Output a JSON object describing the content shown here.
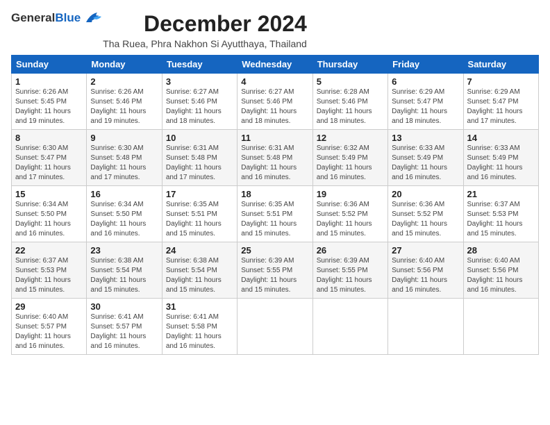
{
  "header": {
    "logo_general": "General",
    "logo_blue": "Blue",
    "month_title": "December 2024",
    "location": "Tha Ruea, Phra Nakhon Si Ayutthaya, Thailand"
  },
  "weekdays": [
    "Sunday",
    "Monday",
    "Tuesday",
    "Wednesday",
    "Thursday",
    "Friday",
    "Saturday"
  ],
  "weeks": [
    [
      {
        "day": "1",
        "info": "Sunrise: 6:26 AM\nSunset: 5:45 PM\nDaylight: 11 hours\nand 19 minutes."
      },
      {
        "day": "2",
        "info": "Sunrise: 6:26 AM\nSunset: 5:46 PM\nDaylight: 11 hours\nand 19 minutes."
      },
      {
        "day": "3",
        "info": "Sunrise: 6:27 AM\nSunset: 5:46 PM\nDaylight: 11 hours\nand 18 minutes."
      },
      {
        "day": "4",
        "info": "Sunrise: 6:27 AM\nSunset: 5:46 PM\nDaylight: 11 hours\nand 18 minutes."
      },
      {
        "day": "5",
        "info": "Sunrise: 6:28 AM\nSunset: 5:46 PM\nDaylight: 11 hours\nand 18 minutes."
      },
      {
        "day": "6",
        "info": "Sunrise: 6:29 AM\nSunset: 5:47 PM\nDaylight: 11 hours\nand 18 minutes."
      },
      {
        "day": "7",
        "info": "Sunrise: 6:29 AM\nSunset: 5:47 PM\nDaylight: 11 hours\nand 17 minutes."
      }
    ],
    [
      {
        "day": "8",
        "info": "Sunrise: 6:30 AM\nSunset: 5:47 PM\nDaylight: 11 hours\nand 17 minutes."
      },
      {
        "day": "9",
        "info": "Sunrise: 6:30 AM\nSunset: 5:48 PM\nDaylight: 11 hours\nand 17 minutes."
      },
      {
        "day": "10",
        "info": "Sunrise: 6:31 AM\nSunset: 5:48 PM\nDaylight: 11 hours\nand 17 minutes."
      },
      {
        "day": "11",
        "info": "Sunrise: 6:31 AM\nSunset: 5:48 PM\nDaylight: 11 hours\nand 16 minutes."
      },
      {
        "day": "12",
        "info": "Sunrise: 6:32 AM\nSunset: 5:49 PM\nDaylight: 11 hours\nand 16 minutes."
      },
      {
        "day": "13",
        "info": "Sunrise: 6:33 AM\nSunset: 5:49 PM\nDaylight: 11 hours\nand 16 minutes."
      },
      {
        "day": "14",
        "info": "Sunrise: 6:33 AM\nSunset: 5:49 PM\nDaylight: 11 hours\nand 16 minutes."
      }
    ],
    [
      {
        "day": "15",
        "info": "Sunrise: 6:34 AM\nSunset: 5:50 PM\nDaylight: 11 hours\nand 16 minutes."
      },
      {
        "day": "16",
        "info": "Sunrise: 6:34 AM\nSunset: 5:50 PM\nDaylight: 11 hours\nand 16 minutes."
      },
      {
        "day": "17",
        "info": "Sunrise: 6:35 AM\nSunset: 5:51 PM\nDaylight: 11 hours\nand 15 minutes."
      },
      {
        "day": "18",
        "info": "Sunrise: 6:35 AM\nSunset: 5:51 PM\nDaylight: 11 hours\nand 15 minutes."
      },
      {
        "day": "19",
        "info": "Sunrise: 6:36 AM\nSunset: 5:52 PM\nDaylight: 11 hours\nand 15 minutes."
      },
      {
        "day": "20",
        "info": "Sunrise: 6:36 AM\nSunset: 5:52 PM\nDaylight: 11 hours\nand 15 minutes."
      },
      {
        "day": "21",
        "info": "Sunrise: 6:37 AM\nSunset: 5:53 PM\nDaylight: 11 hours\nand 15 minutes."
      }
    ],
    [
      {
        "day": "22",
        "info": "Sunrise: 6:37 AM\nSunset: 5:53 PM\nDaylight: 11 hours\nand 15 minutes."
      },
      {
        "day": "23",
        "info": "Sunrise: 6:38 AM\nSunset: 5:54 PM\nDaylight: 11 hours\nand 15 minutes."
      },
      {
        "day": "24",
        "info": "Sunrise: 6:38 AM\nSunset: 5:54 PM\nDaylight: 11 hours\nand 15 minutes."
      },
      {
        "day": "25",
        "info": "Sunrise: 6:39 AM\nSunset: 5:55 PM\nDaylight: 11 hours\nand 15 minutes."
      },
      {
        "day": "26",
        "info": "Sunrise: 6:39 AM\nSunset: 5:55 PM\nDaylight: 11 hours\nand 15 minutes."
      },
      {
        "day": "27",
        "info": "Sunrise: 6:40 AM\nSunset: 5:56 PM\nDaylight: 11 hours\nand 16 minutes."
      },
      {
        "day": "28",
        "info": "Sunrise: 6:40 AM\nSunset: 5:56 PM\nDaylight: 11 hours\nand 16 minutes."
      }
    ],
    [
      {
        "day": "29",
        "info": "Sunrise: 6:40 AM\nSunset: 5:57 PM\nDaylight: 11 hours\nand 16 minutes."
      },
      {
        "day": "30",
        "info": "Sunrise: 6:41 AM\nSunset: 5:57 PM\nDaylight: 11 hours\nand 16 minutes."
      },
      {
        "day": "31",
        "info": "Sunrise: 6:41 AM\nSunset: 5:58 PM\nDaylight: 11 hours\nand 16 minutes."
      },
      {
        "day": "",
        "info": ""
      },
      {
        "day": "",
        "info": ""
      },
      {
        "day": "",
        "info": ""
      },
      {
        "day": "",
        "info": ""
      }
    ]
  ]
}
